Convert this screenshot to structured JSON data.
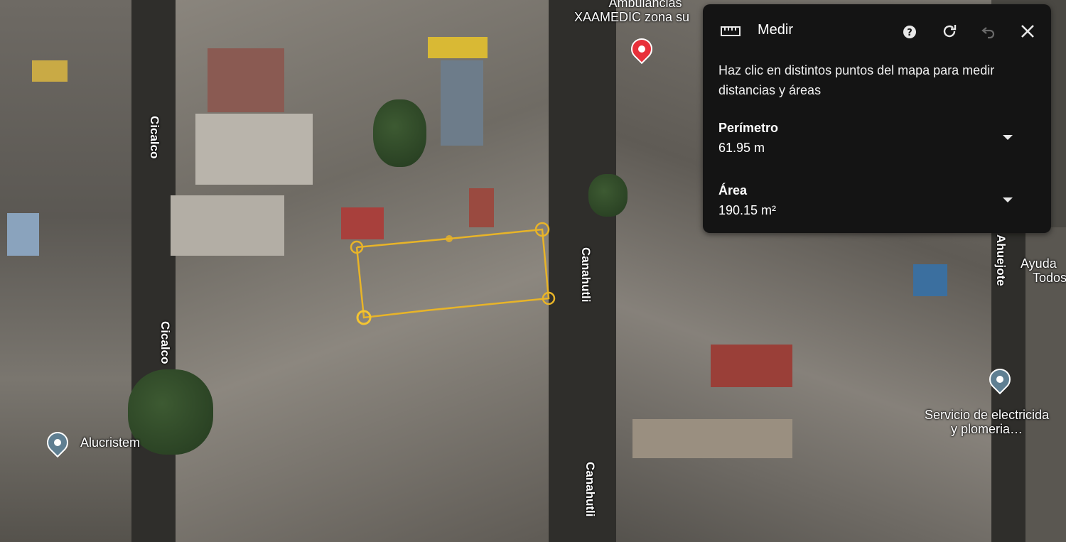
{
  "map": {
    "streets": {
      "cicalco_top": "Cicalco",
      "cicalco_bottom": "Cicalco",
      "canahutli_mid": "Canahutli",
      "canahutli_bottom": "Canahutli",
      "ahuejote": "Ahuejote"
    },
    "places": {
      "ambulancias_line1": "Ambulancias",
      "ambulancias_line2": "XAAMEDIC zona su",
      "alucristem": "Alucristem",
      "ayuda_line1": "Ayuda",
      "ayuda_line2": "Todos",
      "servicio_line1": "Servicio de electricida",
      "servicio_line2": "y plomeria…"
    },
    "colors": {
      "selected_pin": "#e8303a",
      "poi_pin": "#5f7f92",
      "measure_line": "#e8b428"
    }
  },
  "measure_panel": {
    "title": "Medir",
    "icons": {
      "ruler": "ruler-icon",
      "help": "help-icon",
      "reset": "refresh-icon",
      "undo": "undo-icon",
      "close": "close-icon"
    },
    "instruction": "Haz clic en distintos puntos del mapa para medir distancias y áreas",
    "perimeter_label": "Perímetro",
    "perimeter_value": "61.95 m",
    "area_label": "Área",
    "area_value": "190.15 m²"
  }
}
